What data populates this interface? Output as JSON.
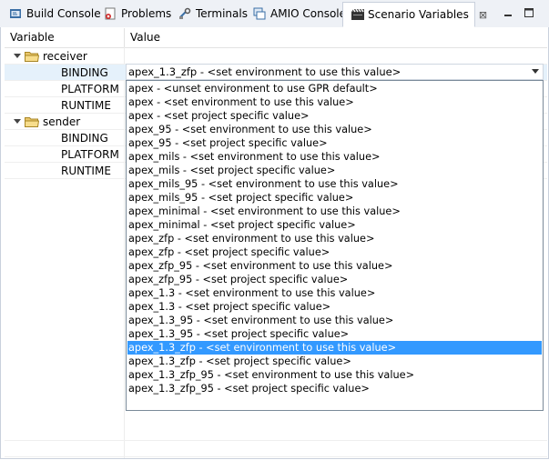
{
  "tabs": [
    {
      "label": "Build Console",
      "icon": "console-icon"
    },
    {
      "label": "Problems",
      "icon": "problems-icon"
    },
    {
      "label": "Terminals",
      "icon": "terminal-icon"
    },
    {
      "label": "AMIO Console",
      "icon": "amio-console-icon"
    },
    {
      "label": "Scenario Variables",
      "icon": "scenario-variables-icon",
      "close": "⊠"
    }
  ],
  "columns": {
    "variable": "Variable",
    "value": "Value"
  },
  "tree": {
    "receiver": {
      "label": "receiver",
      "children": [
        "BINDING",
        "PLATFORM",
        "RUNTIME"
      ]
    },
    "sender": {
      "label": "sender",
      "children": [
        "BINDING",
        "PLATFORM",
        "RUNTIME"
      ]
    }
  },
  "combo": {
    "value": "apex_1.3_zfp - <set environment to use this value>"
  },
  "options": [
    "apex - <unset environment to use GPR default>",
    "apex - <set environment to use this value>",
    "apex - <set project specific value>",
    "apex_95 - <set environment to use this value>",
    "apex_95 - <set project specific value>",
    "apex_mils - <set environment to use this value>",
    "apex_mils - <set project specific value>",
    "apex_mils_95 - <set environment to use this value>",
    "apex_mils_95 - <set project specific value>",
    "apex_minimal - <set environment to use this value>",
    "apex_minimal - <set project specific value>",
    "apex_zfp - <set environment to use this value>",
    "apex_zfp - <set project specific value>",
    "apex_zfp_95 - <set environment to use this value>",
    "apex_zfp_95 - <set project specific value>",
    "apex_1.3 - <set environment to use this value>",
    "apex_1.3 - <set project specific value>",
    "apex_1.3_95 - <set environment to use this value>",
    "apex_1.3_95 - <set project specific value>",
    "apex_1.3_zfp - <set environment to use this value>",
    "apex_1.3_zfp - <set project specific value>",
    "apex_1.3_zfp_95 - <set environment to use this value>",
    "apex_1.3_zfp_95 - <set project specific value>"
  ],
  "selected_index": 19,
  "colors": {
    "selection": "#3399ff",
    "tabbar": "#eef1f6",
    "border": "#c9d0dc"
  }
}
